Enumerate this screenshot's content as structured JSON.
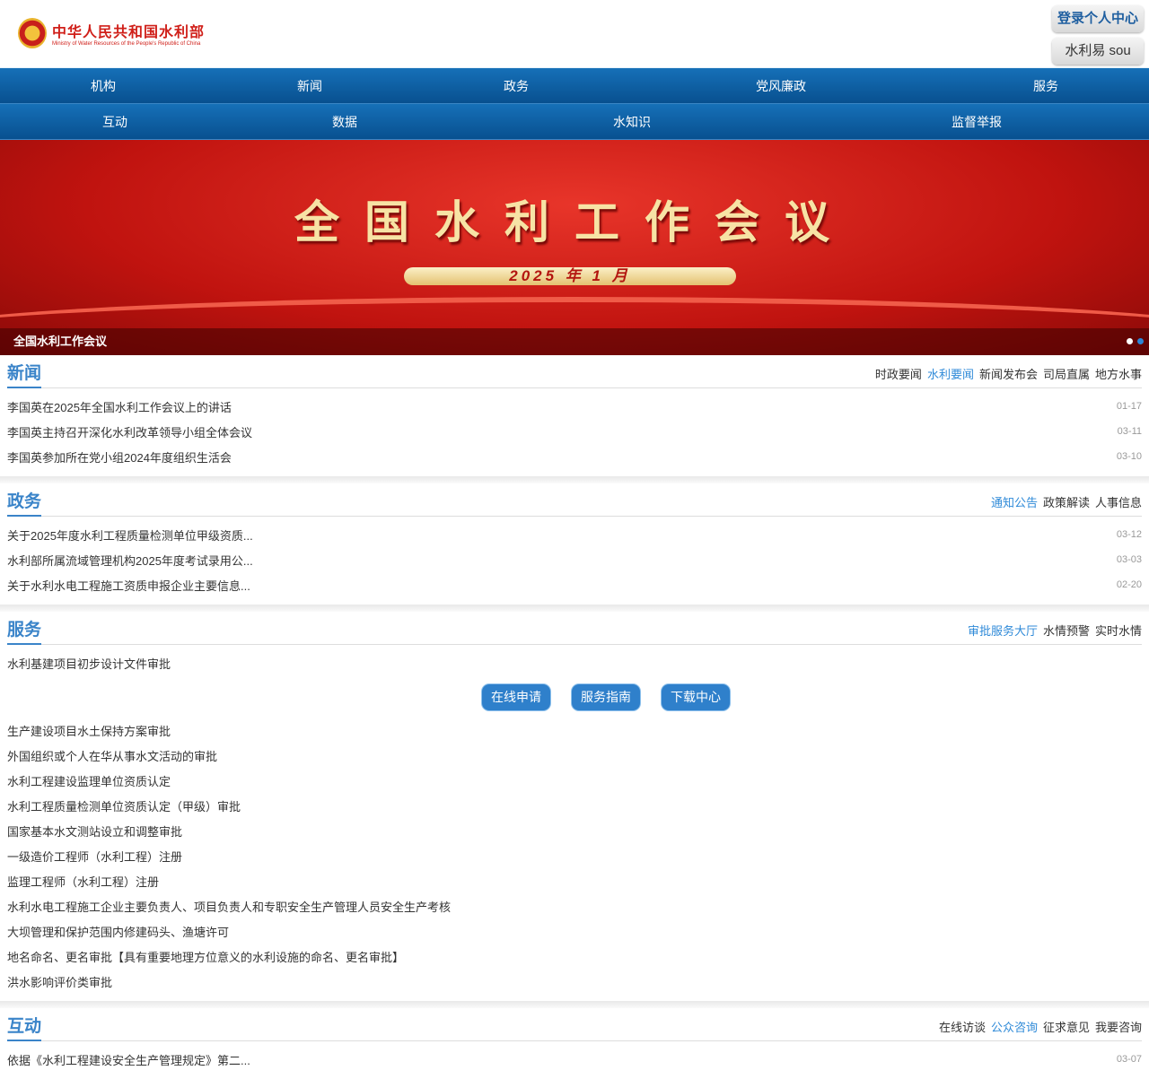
{
  "header": {
    "logo_cn": "中华人民共和国水利部",
    "logo_en": "Ministry of Water Resources of the People's Republic of China",
    "login": "登录个人中心",
    "search": "水利易 sou"
  },
  "nav1": [
    "机构",
    "新闻",
    "政务",
    "党风廉政",
    "服务"
  ],
  "nav2": [
    "互动",
    "数据",
    "水知识",
    "监督举报"
  ],
  "banner": {
    "title": "全国水利工作会议",
    "date": "2025 年 1 月",
    "caption": "全国水利工作会议"
  },
  "news": {
    "title": "新闻",
    "tabs": [
      "时政要闻",
      "水利要闻",
      "新闻发布会",
      "司局直属",
      "地方水事"
    ],
    "active": 1,
    "items": [
      {
        "t": "李国英在2025年全国水利工作会议上的讲话",
        "d": "01-17"
      },
      {
        "t": "李国英主持召开深化水利改革领导小组全体会议",
        "d": "03-11"
      },
      {
        "t": "李国英参加所在党小组2024年度组织生活会",
        "d": "03-10"
      }
    ]
  },
  "gov": {
    "title": "政务",
    "tabs": [
      "通知公告",
      "政策解读",
      "人事信息"
    ],
    "active": 0,
    "items": [
      {
        "t": "关于2025年度水利工程质量检测单位甲级资质...",
        "d": "03-12"
      },
      {
        "t": "水利部所属流域管理机构2025年度考试录用公...",
        "d": "03-03"
      },
      {
        "t": "关于水利水电工程施工资质申报企业主要信息...",
        "d": "02-20"
      }
    ]
  },
  "service": {
    "title": "服务",
    "tabs": [
      "审批服务大厅",
      "水情预警",
      "实时水情"
    ],
    "active": 0,
    "first": "水利基建项目初步设计文件审批",
    "buttons": [
      "在线申请",
      "服务指南",
      "下载中心"
    ],
    "items": [
      "生产建设项目水土保持方案审批",
      "外国组织或个人在华从事水文活动的审批",
      "水利工程建设监理单位资质认定",
      "水利工程质量检测单位资质认定（甲级）审批",
      "国家基本水文测站设立和调整审批",
      "一级造价工程师（水利工程）注册",
      "监理工程师（水利工程）注册",
      "水利水电工程施工企业主要负责人、项目负责人和专职安全生产管理人员安全生产考核",
      "大坝管理和保护范围内修建码头、渔塘许可",
      "地名命名、更名审批【具有重要地理方位意义的水利设施的命名、更名审批】",
      "洪水影响评价类审批"
    ]
  },
  "interact": {
    "title": "互动",
    "tabs": [
      "在线访谈",
      "公众咨询",
      "征求意见",
      "我要咨询"
    ],
    "active": 1,
    "items": [
      {
        "t": "依据《水利工程建设安全生产管理规定》第二...",
        "d": "03-07"
      }
    ]
  }
}
